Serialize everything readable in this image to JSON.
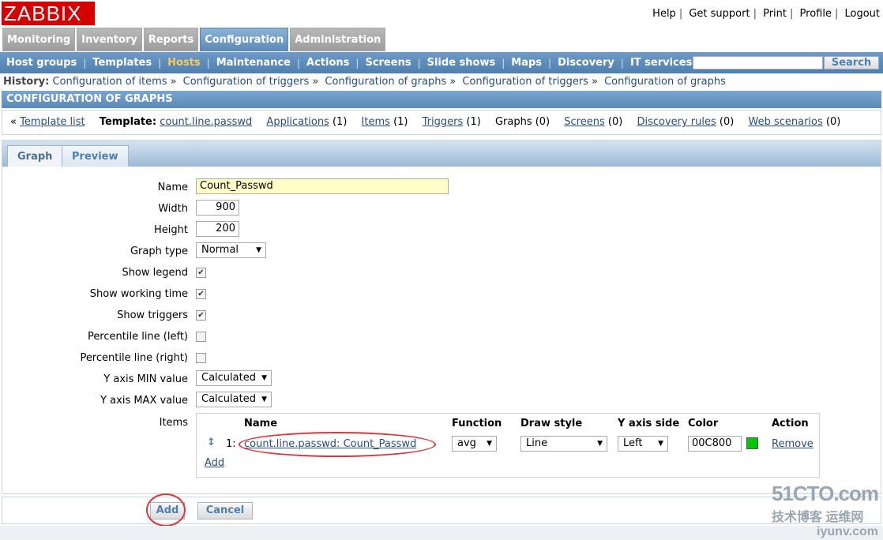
{
  "logo": "ZABBIX",
  "top_links": [
    "Help",
    "Get support",
    "Print",
    "Profile",
    "Logout"
  ],
  "main_menu": [
    "Monitoring",
    "Inventory",
    "Reports",
    "Configuration",
    "Administration"
  ],
  "sub_menu": [
    "Host groups",
    "Templates",
    "Hosts",
    "Maintenance",
    "Actions",
    "Screens",
    "Slide shows",
    "Maps",
    "Discovery",
    "IT services"
  ],
  "search": {
    "placeholder": "",
    "button": "Search"
  },
  "history": {
    "label": "History:",
    "items": [
      "Configuration of items",
      "Configuration of triggers",
      "Configuration of graphs",
      "Configuration of triggers",
      "Configuration of graphs"
    ]
  },
  "section_title": "CONFIGURATION OF GRAPHS",
  "object_nav": {
    "back_prefix": "«",
    "template_list": "Template list",
    "template_label": "Template:",
    "template_name": "count.line.passwd",
    "applications": "Applications",
    "applications_count": "(1)",
    "items": "Items",
    "items_count": "(1)",
    "triggers": "Triggers",
    "triggers_count": "(1)",
    "graphs": "Graphs (0)",
    "screens": "Screens",
    "screens_count": "(0)",
    "discovery": "Discovery rules",
    "discovery_count": "(0)",
    "web": "Web scenarios",
    "web_count": "(0)"
  },
  "tabs": [
    "Graph",
    "Preview"
  ],
  "form": {
    "name_label": "Name",
    "name_value": "Count_Passwd",
    "width_label": "Width",
    "width_value": "900",
    "height_label": "Height",
    "height_value": "200",
    "graph_type_label": "Graph type",
    "graph_type_value": "Normal",
    "show_legend_label": "Show legend",
    "show_legend": true,
    "show_working_time_label": "Show working time",
    "show_working_time": true,
    "show_triggers_label": "Show triggers",
    "show_triggers": true,
    "percentile_left_label": "Percentile line (left)",
    "percentile_left": false,
    "percentile_right_label": "Percentile line (right)",
    "percentile_right": false,
    "ymin_label": "Y axis MIN value",
    "ymin_value": "Calculated",
    "ymax_label": "Y axis MAX value",
    "ymax_value": "Calculated",
    "items_label": "Items"
  },
  "items_table": {
    "headers": [
      "Name",
      "Function",
      "Draw style",
      "Y axis side",
      "Color",
      "Action"
    ],
    "rows": [
      {
        "drag": "↕",
        "index": "1:",
        "name": "count.line.passwd: Count_Passwd",
        "function": "avg",
        "draw_style": "Line",
        "y_axis_side": "Left",
        "color": "00C800",
        "color_hex": "#00c800",
        "action": "Remove"
      }
    ],
    "add_link": "Add"
  },
  "buttons": {
    "add": "Add",
    "cancel": "Cancel"
  },
  "watermark": {
    "line1": "51CTO.com",
    "line2": "技术博客  运维网",
    "line3": "iyunv.com"
  }
}
